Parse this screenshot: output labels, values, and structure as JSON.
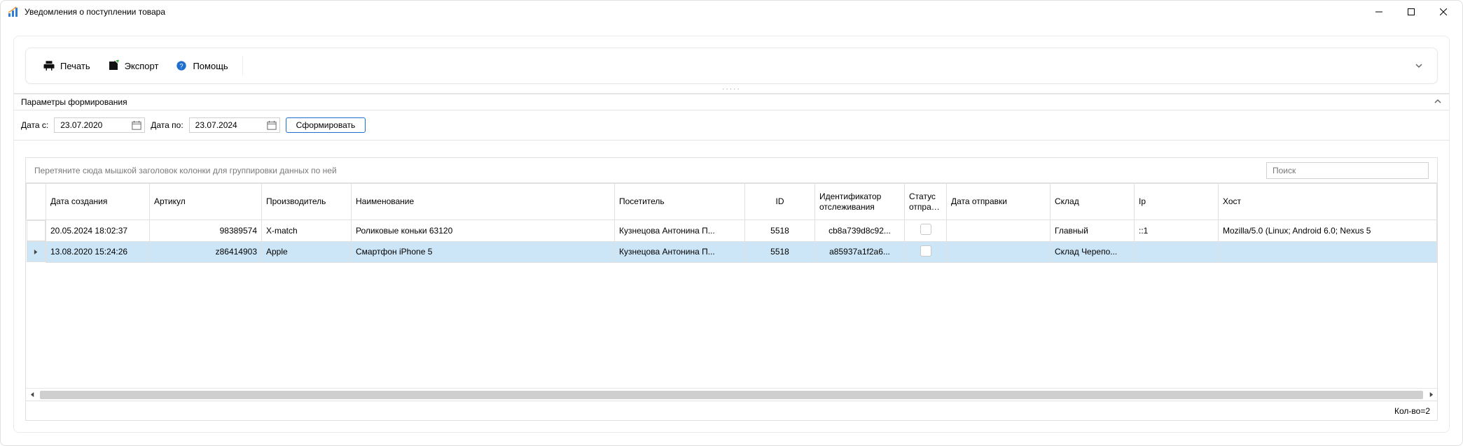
{
  "window": {
    "title": "Уведомления о поступлении товара"
  },
  "toolbar": {
    "print": "Печать",
    "export": "Экспорт",
    "help": "Помощь"
  },
  "params": {
    "header": "Параметры формирования",
    "date_from_label": "Дата с:",
    "date_from": "23.07.2020",
    "date_to_label": "Дата по:",
    "date_to": "23.07.2024",
    "generate": "Сформировать"
  },
  "grid": {
    "group_hint": "Перетяните сюда мышкой заголовок колонки для группировки данных по ней",
    "search_placeholder": "Поиск",
    "columns": {
      "created": "Дата создания",
      "article": "Артикул",
      "manufacturer": "Производитель",
      "name": "Наименование",
      "visitor": "Посетитель",
      "id": "ID",
      "track": "Идентификатор отслеживания",
      "ship_status": "Статус отправки",
      "ship_date": "Дата отправки",
      "warehouse": "Склад",
      "ip": "Ip",
      "host": "Хост"
    },
    "rows": [
      {
        "created": "20.05.2024 18:02:37",
        "article": "98389574",
        "manufacturer": "X-match",
        "name": "Роликовые коньки 63120",
        "visitor": "Кузнецова Антонина П...",
        "id": "5518",
        "track": "cb8a739d8c92...",
        "ship_date": "",
        "warehouse": "Главный",
        "ip": "::1",
        "host": "Mozilla/5.0 (Linux; Android 6.0; Nexus 5 "
      },
      {
        "created": "13.08.2020 15:24:26",
        "article": "z86414903",
        "manufacturer": "Apple",
        "name": "Смартфон iPhone 5",
        "visitor": "Кузнецова Антонина П...",
        "id": "5518",
        "track": "a85937a1f2a6...",
        "ship_date": "",
        "warehouse": "Склад Черепо...",
        "ip": "",
        "host": ""
      }
    ],
    "footer": "Кол-во=2"
  }
}
